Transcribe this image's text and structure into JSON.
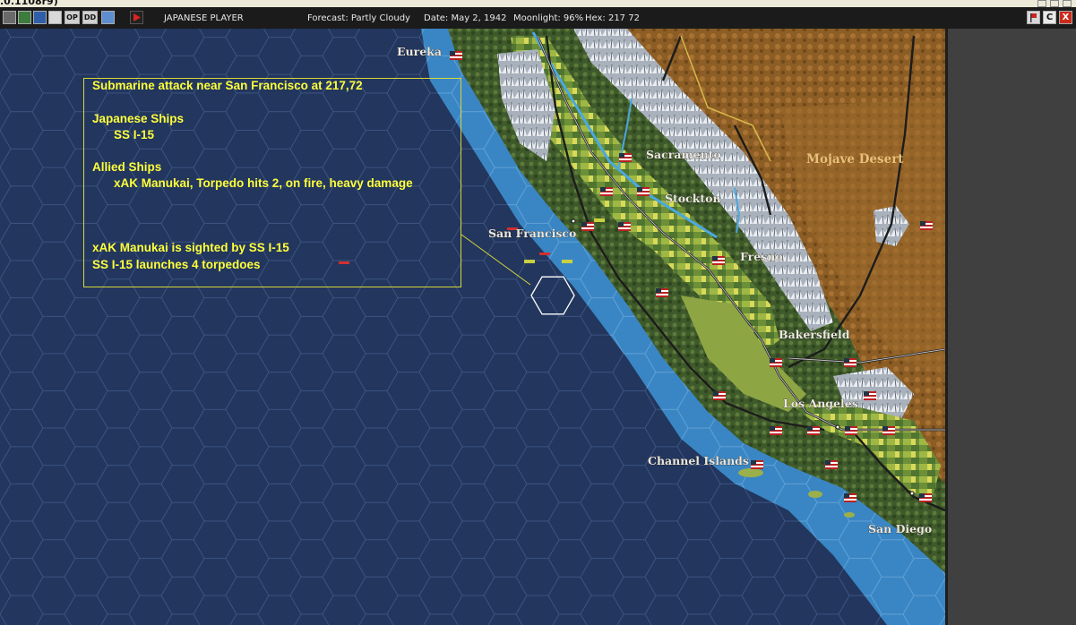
{
  "window": {
    "version_fragment": ".0.1108r9)"
  },
  "toolbar": {
    "player": "JAPANESE PLAYER",
    "forecast": "Forecast: Partly Cloudy",
    "date": "Date: May 2, 1942",
    "moonlight": "Moonlight: 96%",
    "hex": "Hex: 217 72",
    "icons": [
      "exit-icon",
      "globe-icon",
      "settings-icon",
      "op-button",
      "dd-button",
      "map-icon",
      "end-turn-icon"
    ],
    "left_buttons": {
      "op": "OP",
      "dd": "DD"
    },
    "right_buttons": {
      "c": "C",
      "x": "X"
    }
  },
  "colors": {
    "ocean": "#22365e",
    "coast_water": "#3a86c4",
    "report_text": "#ffff3a",
    "land": "#4e6b34",
    "desert": "#8a5f28"
  },
  "combat_report": {
    "title": "Submarine attack near San Francisco  at 217,72",
    "japanese_header": "Japanese Ships",
    "japanese_ships": [
      "SS I-15"
    ],
    "allied_header": "Allied Ships",
    "allied_ships": [
      "xAK Manukai, Torpedo hits 2,  on fire,  heavy damage"
    ],
    "events": [
      "xAK Manukai is sighted by SS I-15",
      "SS I-15 launches 4 torpedoes"
    ]
  },
  "map": {
    "cities": [
      "Eureka",
      "Sacramento",
      "Stockton",
      "San Francisco",
      "Fresno",
      "Bakersfield",
      "Los Angeles",
      "Channel Islands",
      "San Diego"
    ],
    "regions": [
      "Mojave Desert"
    ]
  }
}
